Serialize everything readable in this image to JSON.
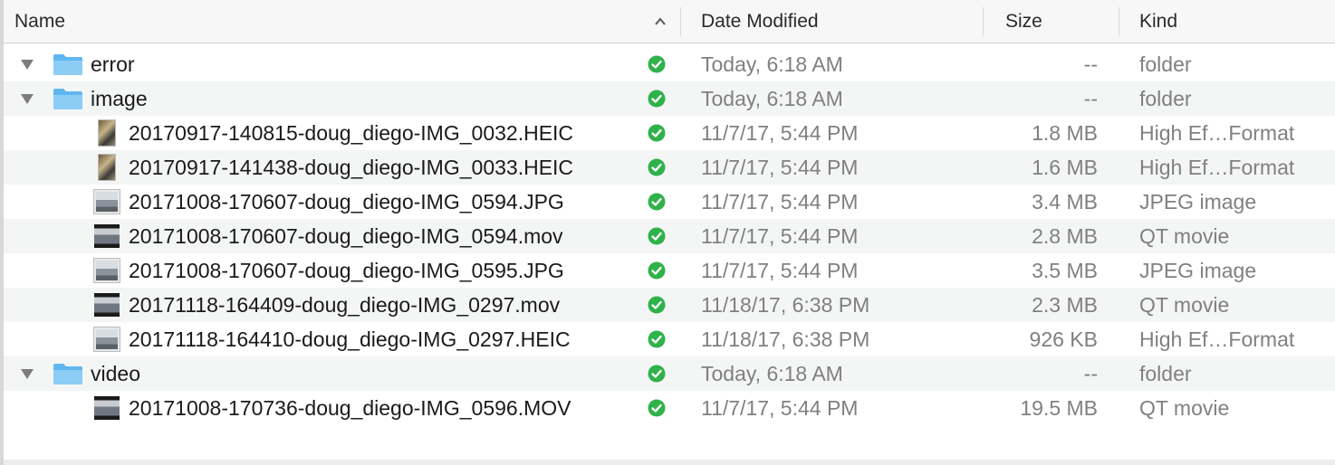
{
  "columns": {
    "name": "Name",
    "date_modified": "Date Modified",
    "size": "Size",
    "kind": "Kind"
  },
  "sort": {
    "column": "Name",
    "direction": "ascending",
    "icon": "chevron-up-icon"
  },
  "colors": {
    "folder": "#5fb7f0",
    "status_ok": "#2fb24a",
    "secondary_text": "#808080"
  },
  "rows": [
    {
      "type": "folder",
      "expanded": true,
      "name": "error",
      "date": "Today, 6:18 AM",
      "size": "--",
      "kind": "folder",
      "status": "synced"
    },
    {
      "type": "folder",
      "expanded": true,
      "name": "image",
      "date": "Today, 6:18 AM",
      "size": "--",
      "kind": "folder",
      "status": "synced"
    },
    {
      "type": "file",
      "thumb": "photo-portrait",
      "name": "20170917-140815-doug_diego-IMG_0032.HEIC",
      "date": "11/7/17, 5:44 PM",
      "size": "1.8 MB",
      "kind": "High Ef…Format",
      "status": "synced"
    },
    {
      "type": "file",
      "thumb": "photo-portrait",
      "name": "20170917-141438-doug_diego-IMG_0033.HEIC",
      "date": "11/7/17, 5:44 PM",
      "size": "1.6 MB",
      "kind": "High Ef…Format",
      "status": "synced"
    },
    {
      "type": "file",
      "thumb": "photo-landscape",
      "name": "20171008-170607-doug_diego-IMG_0594.JPG",
      "date": "11/7/17, 5:44 PM",
      "size": "3.4 MB",
      "kind": "JPEG image",
      "status": "synced"
    },
    {
      "type": "file",
      "thumb": "movie",
      "name": "20171008-170607-doug_diego-IMG_0594.mov",
      "date": "11/7/17, 5:44 PM",
      "size": "2.8 MB",
      "kind": "QT movie",
      "status": "synced"
    },
    {
      "type": "file",
      "thumb": "photo-landscape",
      "name": "20171008-170607-doug_diego-IMG_0595.JPG",
      "date": "11/7/17, 5:44 PM",
      "size": "3.5 MB",
      "kind": "JPEG image",
      "status": "synced"
    },
    {
      "type": "file",
      "thumb": "movie",
      "name": "20171118-164409-doug_diego-IMG_0297.mov",
      "date": "11/18/17, 6:38 PM",
      "size": "2.3 MB",
      "kind": "QT movie",
      "status": "synced"
    },
    {
      "type": "file",
      "thumb": "photo-landscape",
      "name": "20171118-164410-doug_diego-IMG_0297.HEIC",
      "date": "11/18/17, 6:38 PM",
      "size": "926 KB",
      "kind": "High Ef…Format",
      "status": "synced"
    },
    {
      "type": "folder",
      "expanded": true,
      "name": "video",
      "date": "Today, 6:18 AM",
      "size": "--",
      "kind": "folder",
      "status": "synced"
    },
    {
      "type": "file",
      "thumb": "movie",
      "name": "20171008-170736-doug_diego-IMG_0596.MOV",
      "date": "11/7/17, 5:44 PM",
      "size": "19.5 MB",
      "kind": "QT movie",
      "status": "synced"
    }
  ]
}
